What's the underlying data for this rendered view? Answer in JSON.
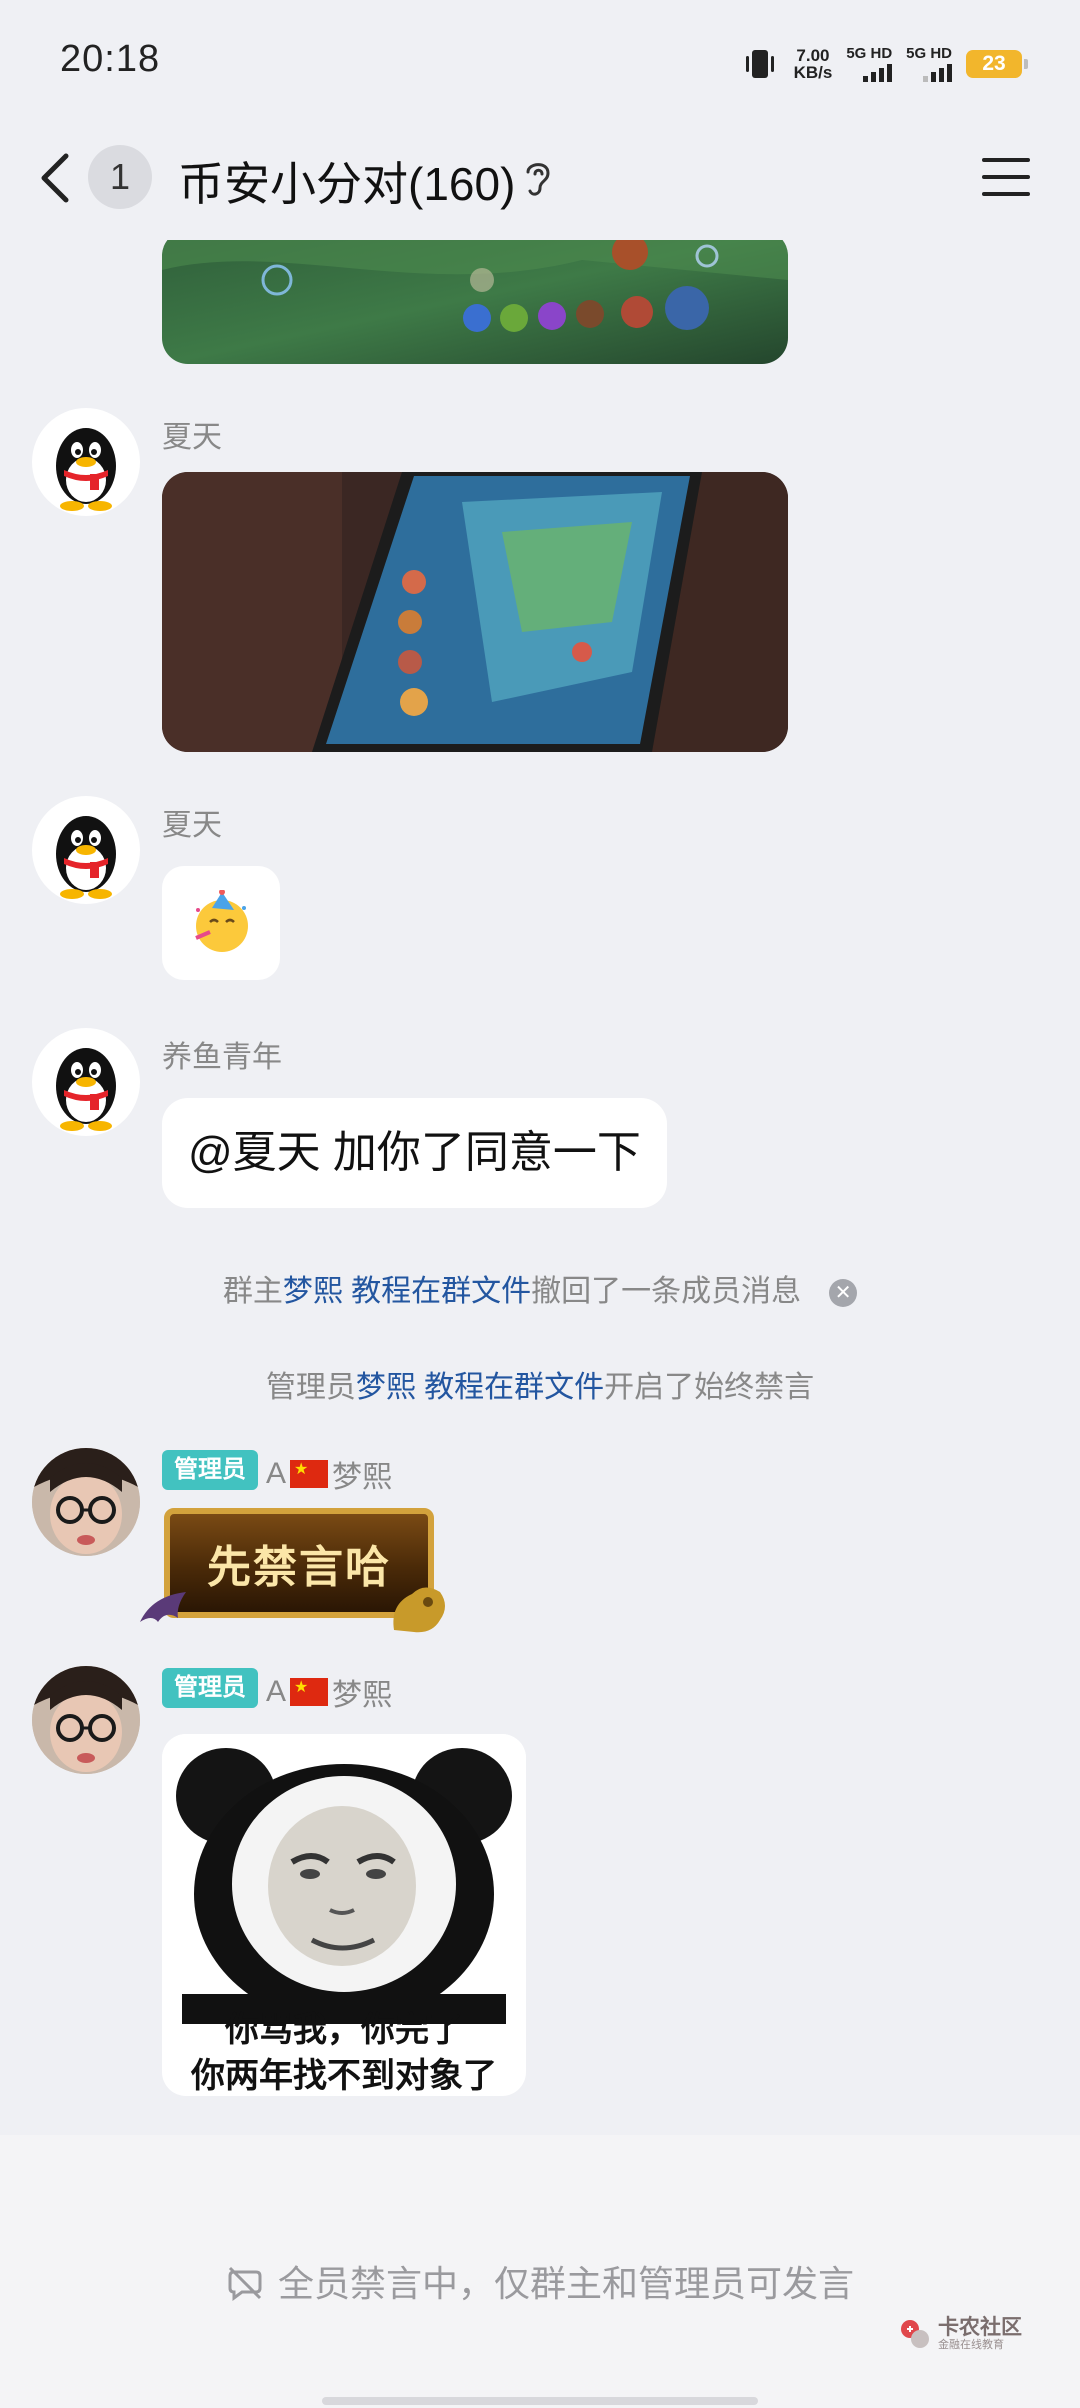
{
  "status_bar": {
    "time": "20:18",
    "net_speed_value": "7.00",
    "net_speed_unit": "KB/s",
    "sim1_label": "5G HD",
    "sim2_label": "5G HD",
    "battery": "23"
  },
  "header": {
    "unread_count": "1",
    "title": "币安小分对(160)"
  },
  "messages": {
    "msg2": {
      "sender": "夏天"
    },
    "msg3": {
      "sender": "夏天"
    },
    "msg4": {
      "sender": "养鱼青年",
      "text": "@夏天 加你了同意一下"
    },
    "msg5": {
      "admin_tag": "管理员",
      "name_prefix": "A",
      "name_suffix": "梦熙",
      "sticker_text": "先禁言哈"
    },
    "msg6": {
      "admin_tag": "管理员",
      "name_prefix": "A",
      "name_suffix": "梦熙",
      "sticker_line1": "你骂我，你完了",
      "sticker_line2": "你两年找不到对象了"
    }
  },
  "system_notices": {
    "recall": {
      "prefix": "群主",
      "link": "梦熙 教程在群文件",
      "suffix": "撤回了一条成员消息"
    },
    "mute": {
      "prefix": "管理员",
      "link": "梦熙 教程在群文件",
      "suffix": "开启了始终禁言"
    }
  },
  "bottom": {
    "mute_notice": "全员禁言中，仅群主和管理员可发言",
    "watermark_main": "卡农社区",
    "watermark_sub": "金融在线教育"
  },
  "colors": {
    "background": "#eff0f4",
    "admin_tag": "#42c2c0",
    "link": "#2356a0",
    "battery": "#f2b62c"
  },
  "icons": [
    "vibrate-icon",
    "back-icon",
    "ear-icon",
    "menu-icon",
    "dismiss-icon",
    "mute-icon"
  ]
}
